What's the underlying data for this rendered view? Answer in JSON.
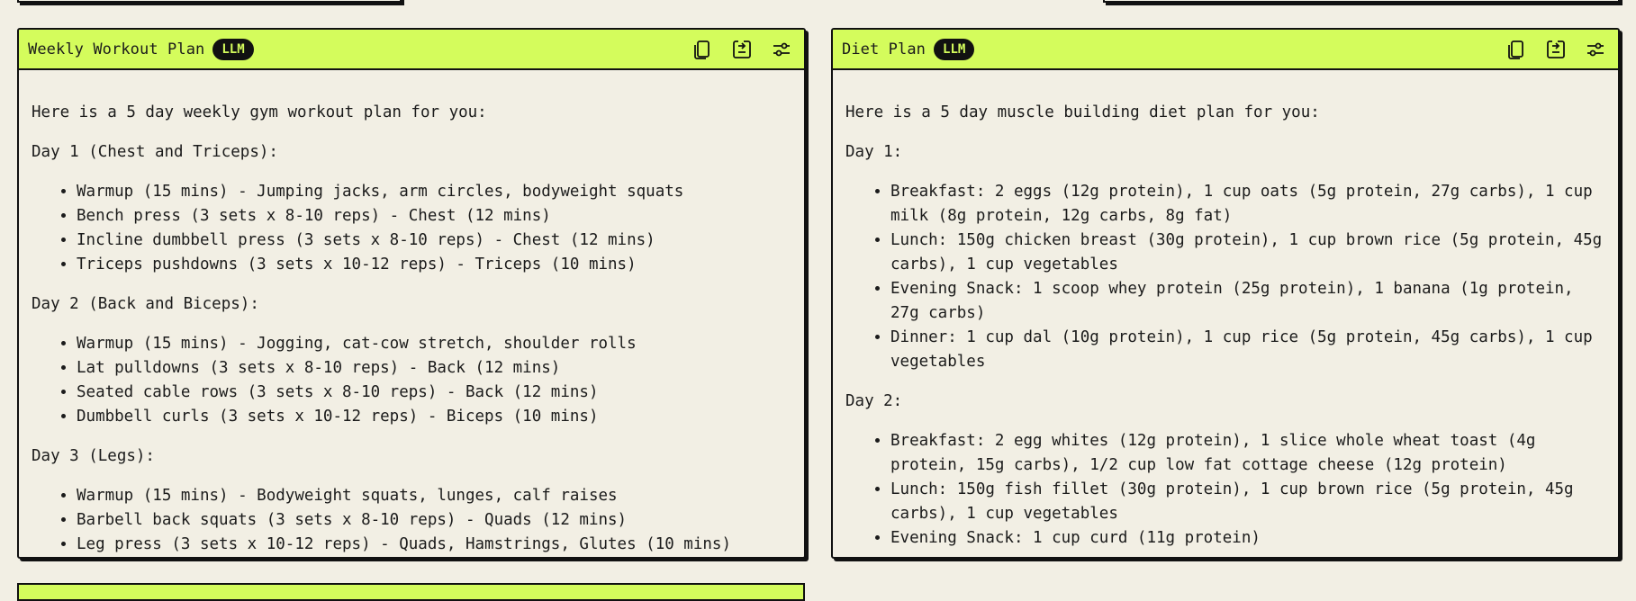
{
  "panels": [
    {
      "title": "Weekly Workout Plan",
      "badge": "LLM",
      "intro": "Here is a 5 day weekly gym workout plan for you:",
      "sections": [
        {
          "heading": "Day 1 (Chest and Triceps):",
          "items": [
            "Warmup (15 mins) - Jumping jacks, arm circles, bodyweight squats",
            "Bench press (3 sets x 8-10 reps) - Chest (12 mins)",
            "Incline dumbbell press (3 sets x 8-10 reps) - Chest (12 mins)",
            "Triceps pushdowns (3 sets x 10-12 reps) - Triceps (10 mins)"
          ]
        },
        {
          "heading": "Day 2 (Back and Biceps):",
          "items": [
            "Warmup (15 mins) - Jogging, cat-cow stretch, shoulder rolls",
            "Lat pulldowns (3 sets x 8-10 reps) - Back (12 mins)",
            "Seated cable rows (3 sets x 8-10 reps) - Back (12 mins)",
            "Dumbbell curls (3 sets x 10-12 reps) - Biceps (10 mins)"
          ]
        },
        {
          "heading": "Day 3 (Legs):",
          "items": [
            "Warmup (15 mins) - Bodyweight squats, lunges, calf raises",
            "Barbell back squats (3 sets x 8-10 reps) - Quads (12 mins)",
            "Leg press (3 sets x 10-12 reps) - Quads, Hamstrings, Glutes (10 mins)"
          ]
        }
      ]
    },
    {
      "title": "Diet Plan",
      "badge": "LLM",
      "intro": "Here is a 5 day muscle building diet plan for you:",
      "sections": [
        {
          "heading": "Day 1:",
          "items": [
            "Breakfast: 2 eggs (12g protein), 1 cup oats (5g protein, 27g carbs), 1 cup milk (8g protein, 12g carbs, 8g fat)",
            "Lunch: 150g chicken breast (30g protein), 1 cup brown rice (5g protein, 45g carbs), 1 cup vegetables",
            "Evening Snack: 1 scoop whey protein (25g protein), 1 banana (1g protein, 27g carbs)",
            "Dinner: 1 cup dal (10g protein), 1 cup rice (5g protein, 45g carbs), 1 cup vegetables"
          ]
        },
        {
          "heading": "Day 2:",
          "items": [
            "Breakfast: 2 egg whites (12g protein), 1 slice whole wheat toast (4g protein, 15g carbs), 1/2 cup low fat cottage cheese (12g protein)",
            "Lunch: 150g fish fillet (30g protein), 1 cup brown rice (5g protein, 45g carbs), 1 cup vegetables",
            "Evening Snack: 1 cup curd (11g protein)"
          ]
        }
      ]
    }
  ],
  "icons": [
    "copy-icon",
    "export-icon",
    "settings-sliders-icon"
  ],
  "colors": {
    "header": "#d4fc5c",
    "background": "#f2efe4",
    "border": "#111111"
  }
}
